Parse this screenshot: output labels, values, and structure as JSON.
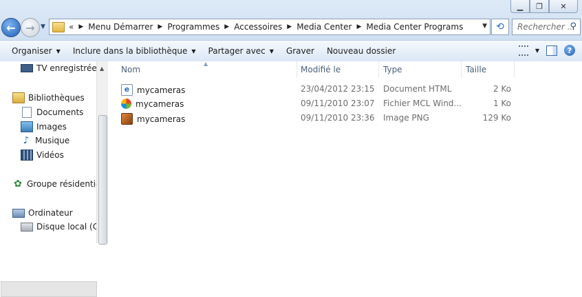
{
  "window": {
    "minimize_icon": "minimize-icon",
    "restore_icon": "restore-icon",
    "close_icon": "close-icon"
  },
  "address": {
    "more": "«",
    "crumbs": [
      "Menu Démarrer",
      "Programmes",
      "Accessoires",
      "Media Center",
      "Media Center Programs"
    ]
  },
  "search": {
    "placeholder": "Rechercher ..."
  },
  "toolbar": {
    "organize": "Organiser",
    "include": "Inclure dans la bibliothèque",
    "share": "Partager avec",
    "burn": "Graver",
    "new_folder": "Nouveau dossier"
  },
  "nav": {
    "tv": "TV enregistrée",
    "libraries": "Bibliothèques",
    "documents": "Documents",
    "images": "Images",
    "music": "Musique",
    "videos": "Vidéos",
    "homegroup": "Groupe résidentiel",
    "computer": "Ordinateur",
    "local_disk": "Disque local (C:)"
  },
  "columns": {
    "name": "Nom",
    "modified": "Modifié le",
    "type": "Type",
    "size": "Taille"
  },
  "files": [
    {
      "name": "mycameras",
      "modified": "23/04/2012 23:15",
      "type": "Document HTML",
      "size": "2 Ko",
      "icon": "html-file-icon"
    },
    {
      "name": "mycameras",
      "modified": "09/11/2010 23:07",
      "type": "Fichier MCL Wind...",
      "size": "1 Ko",
      "icon": "mcl-file-icon"
    },
    {
      "name": "mycameras",
      "modified": "09/11/2010 23:36",
      "type": "Image PNG",
      "size": "129 Ko",
      "icon": "png-file-icon"
    }
  ],
  "colors": {
    "accent": "#1d5fb8",
    "toolbar_bg": "#dbe7f5",
    "selection": "#e5e5e5"
  }
}
